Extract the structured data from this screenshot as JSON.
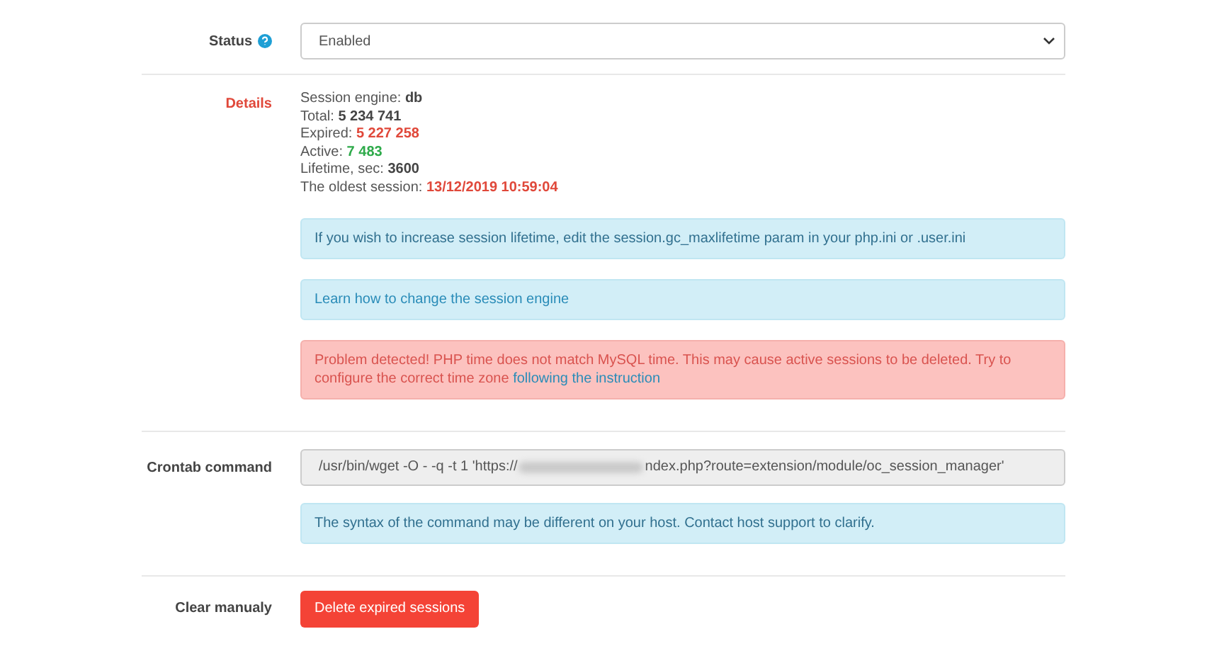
{
  "status": {
    "label": "Status",
    "value": "Enabled"
  },
  "details": {
    "label": "Details",
    "lines": [
      {
        "label": "Session engine:",
        "value": "db",
        "kind": "plain"
      },
      {
        "label": "Total:",
        "value": "5 234 741",
        "kind": "plain"
      },
      {
        "label": "Expired:",
        "value": "5 227 258",
        "kind": "danger"
      },
      {
        "label": "Active:",
        "value": "7 483",
        "kind": "success"
      },
      {
        "label": "Lifetime, sec:",
        "value": "3600",
        "kind": "plain"
      },
      {
        "label": "The oldest session:",
        "value": "13/12/2019 10:59:04",
        "kind": "danger"
      }
    ],
    "alerts": [
      {
        "kind": "info",
        "text": "If you wish to increase session lifetime, edit the session.gc_maxlifetime param in your php.ini or .user.ini"
      },
      {
        "kind": "info",
        "link": "Learn how to change the session engine"
      },
      {
        "kind": "danger",
        "text": "Problem detected! PHP time does not match MySQL time. This may cause active sessions to be deleted. Try to configure the correct time zone",
        "link": "following the instruction"
      }
    ]
  },
  "crontab": {
    "label": "Crontab command",
    "command_start": "/usr/bin/wget -O - -q -t 1 'https://",
    "command_end": "ndex.php?route=extension/module/oc_session_manager'",
    "note": "The syntax of the command may be different on your host. Contact host support to clarify."
  },
  "clear": {
    "label": "Clear manualy",
    "button": "Delete expired sessions"
  }
}
